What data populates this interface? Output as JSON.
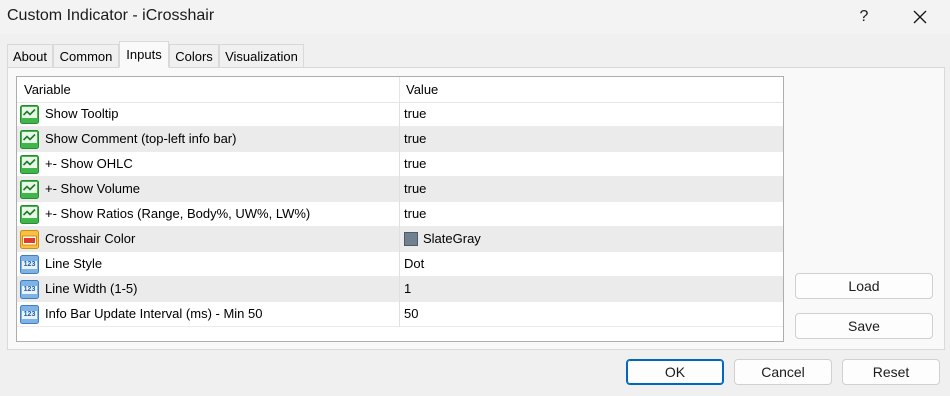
{
  "window": {
    "title": "Custom Indicator - iCrosshair",
    "help": "?"
  },
  "tabs": [
    {
      "label": "About"
    },
    {
      "label": "Common"
    },
    {
      "label": "Inputs",
      "active": true
    },
    {
      "label": "Colors"
    },
    {
      "label": "Visualization"
    }
  ],
  "grid": {
    "headers": {
      "variable": "Variable",
      "value": "Value"
    },
    "rows": [
      {
        "icon": "bool-icon",
        "name": "Show Tooltip",
        "value": "true"
      },
      {
        "icon": "bool-icon",
        "name": "Show Comment (top-left info bar)",
        "value": "true"
      },
      {
        "icon": "bool-icon",
        "name": "+- Show OHLC",
        "value": "true"
      },
      {
        "icon": "bool-icon",
        "name": "+- Show Volume",
        "value": "true"
      },
      {
        "icon": "bool-icon",
        "name": "+- Show Ratios (Range, Body%, UW%, LW%)",
        "value": "true"
      },
      {
        "icon": "color-icon",
        "name": "Crosshair Color",
        "value": "SlateGray",
        "swatch": "#708090"
      },
      {
        "icon": "int-icon",
        "name": "Line Style",
        "value": "Dot"
      },
      {
        "icon": "int-icon",
        "name": "Line Width (1-5)",
        "value": "1"
      },
      {
        "icon": "int-icon",
        "name": "Info Bar Update Interval (ms) - Min 50",
        "value": "50"
      }
    ]
  },
  "side_buttons": {
    "load": "Load",
    "save": "Save"
  },
  "footer_buttons": {
    "ok": "OK",
    "cancel": "Cancel",
    "reset": "Reset"
  },
  "colors": {
    "accent": "#0067c0",
    "alt_row": "#ebebeb",
    "swatch": "#708090"
  }
}
